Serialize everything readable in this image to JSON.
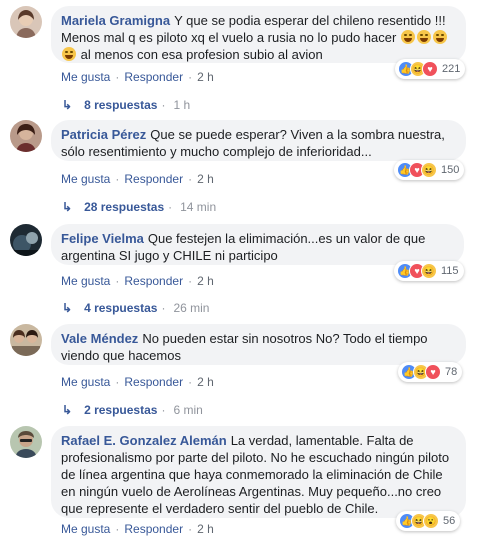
{
  "comments": [
    {
      "author": "Mariela Gramigna",
      "text1": "Y que se podia esperar del chileno resentido !!!",
      "text2": "Menos mal q es piloto xq el vuelo a rusia no lo pudo hacer",
      "text3": "al menos con esa profesion subio al avion",
      "like": "Me gusta",
      "reply": "Responder",
      "time": "2 h",
      "reaction_count": "221",
      "reaction_icons": [
        "like-icon",
        "haha-icon",
        "love-icon"
      ],
      "replies": "8 respuestas",
      "replies_time": "1 h"
    },
    {
      "author": "Patricia Pérez",
      "text": "Que se puede esperar? Viven a la sombra nuestra, sólo resentimiento y mucho complejo de inferioridad...",
      "like": "Me gusta",
      "reply": "Responder",
      "time": "2 h",
      "reaction_count": "150",
      "reaction_icons": [
        "like-icon",
        "love-icon",
        "haha-icon"
      ],
      "replies": "28 respuestas",
      "replies_time": "14 min"
    },
    {
      "author": "Felipe Vielma",
      "text": "Que festejen la elimimación...es un valor de que argentina SI jugo y CHILE ni participo",
      "like": "Me gusta",
      "reply": "Responder",
      "time": "2 h",
      "reaction_count": "115",
      "reaction_icons": [
        "like-icon",
        "love-icon",
        "haha-icon"
      ],
      "replies": "4 respuestas",
      "replies_time": "26 min"
    },
    {
      "author": "Vale Méndez",
      "text": "No pueden estar sin nosotros No? Todo el tiempo viendo que hacemos",
      "like": "Me gusta",
      "reply": "Responder",
      "time": "2 h",
      "reaction_count": "78",
      "reaction_icons": [
        "like-icon",
        "haha-icon",
        "love-icon"
      ],
      "replies": "2 respuestas",
      "replies_time": "6 min"
    },
    {
      "author": "Rafael E. Gonzalez Alemán",
      "text": "La verdad, lamentable. Falta de profesionalismo por parte del piloto. No he escuchado ningún piloto de línea argentina que haya conmemorado la eliminación de Chile en ningún vuelo de Aerolíneas Argentinas. Muy pequeño...no creo que represente el verdadero sentir del pueblo de Chile.",
      "like": "Me gusta",
      "reply": "Responder",
      "time": "2 h",
      "reaction_count": "56",
      "reaction_icons": [
        "like-icon",
        "haha-icon",
        "wow-icon"
      ]
    }
  ]
}
